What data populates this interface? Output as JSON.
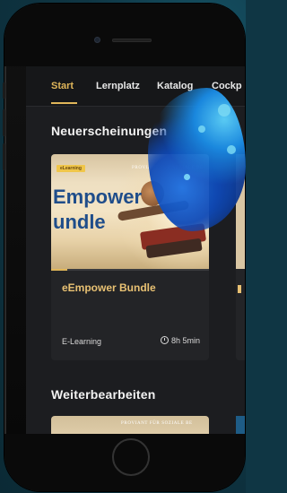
{
  "tabs": [
    {
      "label": "Start",
      "active": true
    },
    {
      "label": "Lernplatz",
      "active": false
    },
    {
      "label": "Katalog",
      "active": false
    },
    {
      "label": "Cockp",
      "active": false
    }
  ],
  "sections": {
    "new_releases": "Neuerscheinungen",
    "continue": "Weiterbearbeiten"
  },
  "course_card": {
    "brand": "PROVIANT FÜR SOZIALE BE",
    "tag": "eLearning",
    "headline_line1": "Empower",
    "headline_line2": "undle",
    "title": "eEmpower Bundle",
    "type": "E-Learning",
    "duration": "8h 5min",
    "progress": 0.1
  },
  "continue_card": {
    "brand": "PROVIANT FÜR SOZIALE BE"
  },
  "colors": {
    "accent": "#e0b65a",
    "card_title": "#e8c173",
    "screen_bg": "#1c1d20",
    "backdrop": "#0f3644"
  }
}
